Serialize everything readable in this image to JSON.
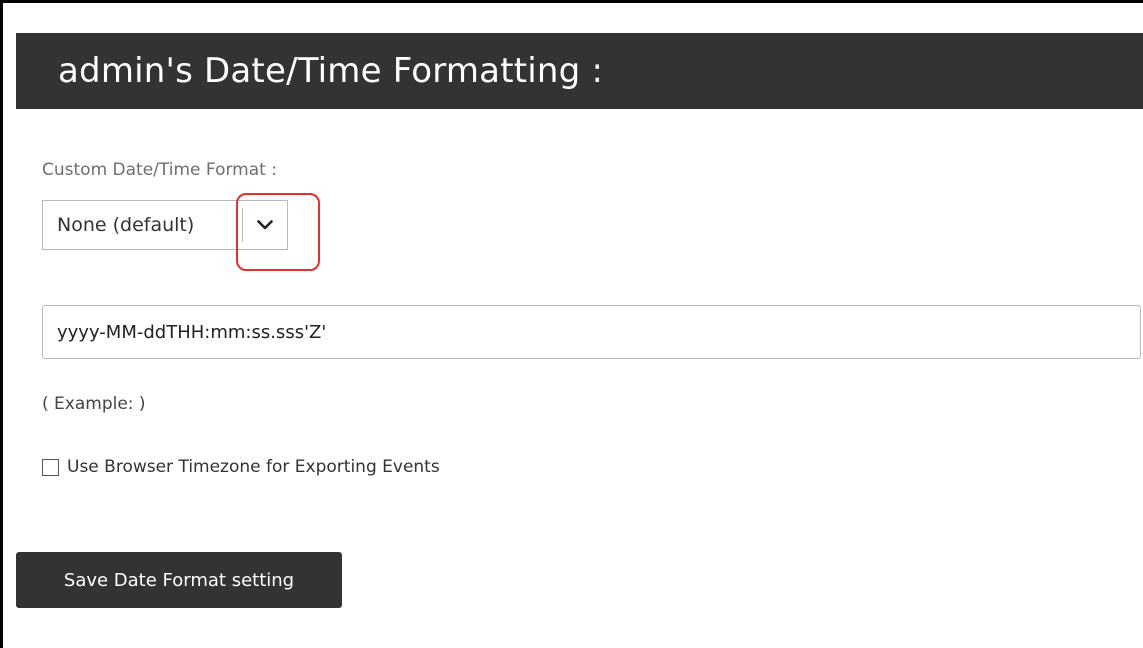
{
  "header": {
    "title": "admin's Date/Time Formatting :"
  },
  "form": {
    "format_label": "Custom Date/Time Format :",
    "format_select": {
      "selected": "None (default)",
      "arrow_icon": "chevron-down-icon"
    },
    "format_input": {
      "value": "yyyy-MM-ddTHH:mm:ss.sss'Z'"
    },
    "example_text": "( Example: )",
    "browser_timezone": {
      "label": "Use Browser Timezone for Exporting Events",
      "checked": false
    },
    "save_label": "Save Date Format setting"
  },
  "colors": {
    "header_bg": "#333333",
    "button_bg": "#333333",
    "highlight": "#e53030"
  }
}
